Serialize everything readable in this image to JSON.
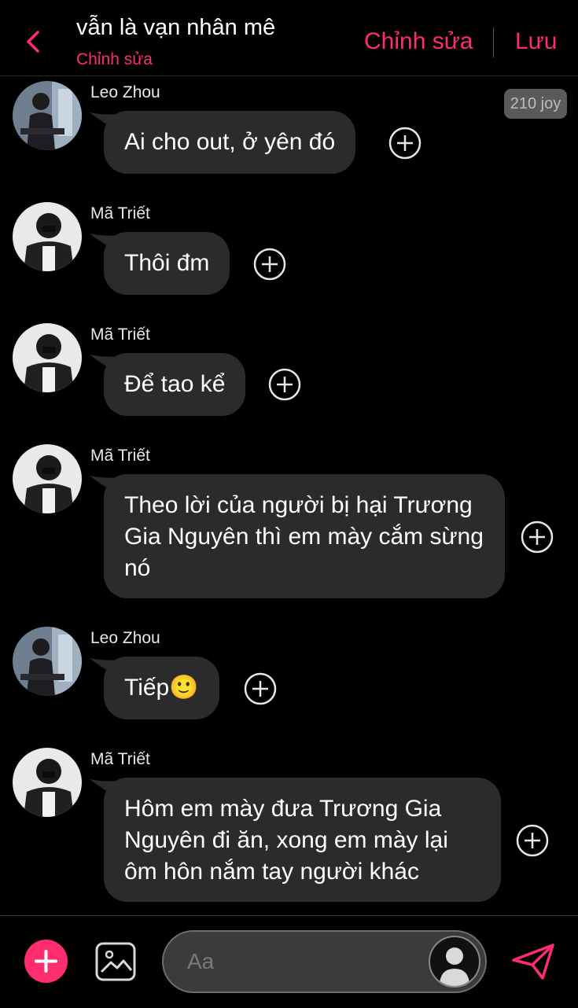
{
  "header": {
    "title": "vẫn là vạn nhân mê",
    "subtitle": "Chỉnh sửa",
    "edit_label": "Chỉnh sửa",
    "save_label": "Lưu",
    "back_icon": "chevron-left-icon",
    "accent": "#ff2d6f"
  },
  "joy_badge": "210 joy",
  "messages": [
    {
      "sender": "Leo Zhou",
      "text": "Ai cho out, ở yên đó"
    },
    {
      "sender": "Mã Triết",
      "text": "Thôi đm"
    },
    {
      "sender": "Mã Triết",
      "text": "Để tao kể"
    },
    {
      "sender": "Mã Triết",
      "text": "Theo lời của người bị hại Trương Gia Nguyên thì em mày cắm sừng nó"
    },
    {
      "sender": "Leo Zhou",
      "text": "Tiếp🙂"
    },
    {
      "sender": "Mã Triết",
      "text": "Hôm em mày đưa Trương Gia Nguyên đi ăn, xong em mày lại ôm hôn nắm tay người khác"
    }
  ],
  "composer": {
    "placeholder": "Aa",
    "add_icon": "plus-icon",
    "image_icon": "image-icon",
    "send_icon": "send-icon"
  },
  "colors": {
    "bubble": "#2b2b2c",
    "background": "#000000"
  }
}
